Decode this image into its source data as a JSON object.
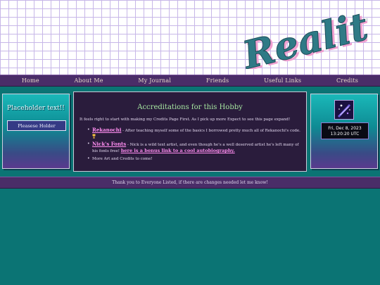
{
  "header": {
    "logo_text": "Reality"
  },
  "nav": [
    {
      "label": "Home"
    },
    {
      "label": "About Me"
    },
    {
      "label": "My Journal"
    },
    {
      "label": "Friends"
    },
    {
      "label": "Useful Links"
    },
    {
      "label": "Credits"
    }
  ],
  "left_sidebar": {
    "title": "Placeholder text!!",
    "button_label": "Pleasese Holder"
  },
  "main": {
    "title": "Accreditations for this Hobby",
    "intro": "It feels right to start with making my Credits Page First. As I pick up more Expect to see this page expand!",
    "credits": [
      {
        "name": "Rekanochi",
        "text": " - After teaching myself some of the basics I borrowed pretty much all of Rekanochi's code."
      },
      {
        "name": "Nick's Fonts",
        "text": " - Nick is a wild text artist, and even though he's a well deserved artist he's left many of his fonts free! ",
        "extra_link": "here is a bonus link to a cool autobiography."
      },
      {
        "text": "More Art and Credits to come!"
      }
    ]
  },
  "right_sidebar": {
    "clock_date": "Fri, Dec 8, 2023",
    "clock_time": "13:20:20 UTC"
  },
  "footer": {
    "text": "Thank you to Everyone Listed, if there are changes needed let me know!"
  },
  "colors": {
    "background": "#0b7474",
    "nav_bg": "#4a2d68",
    "main_bg": "#2a1c3c",
    "link": "#ff8df0",
    "title_green": "#a6e6a0"
  }
}
